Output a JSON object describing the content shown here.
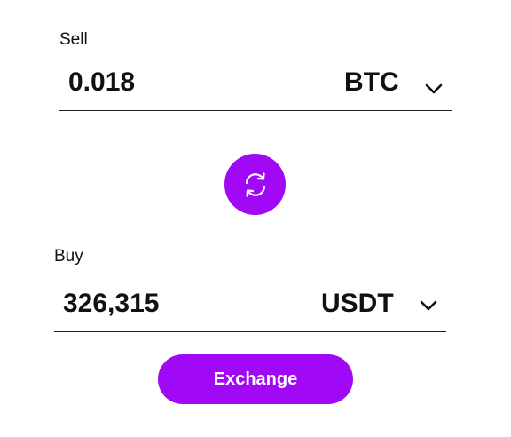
{
  "sell": {
    "label": "Sell",
    "amount": "0.018",
    "currency": "BTC"
  },
  "swap": {
    "icon": "swap-arrows-icon"
  },
  "buy": {
    "label": "Buy",
    "amount": "326,315",
    "currency": "USDT"
  },
  "actions": {
    "exchange_label": "Exchange"
  },
  "colors": {
    "accent": "#a108f5",
    "text": "#111111",
    "underline": "#222222"
  }
}
